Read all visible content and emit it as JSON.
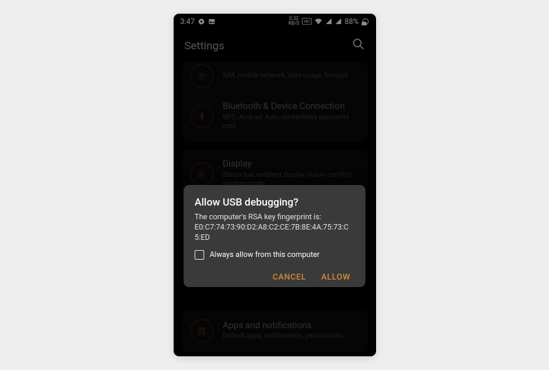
{
  "statusbar": {
    "time": "3:47",
    "data_speed_top": "0.32",
    "data_speed_bottom": "KB/S",
    "battery": "88%"
  },
  "appbar": {
    "title": "Settings"
  },
  "rows": {
    "wifi": {
      "sub": "SIM, mobile network, data usage, hotspot"
    },
    "bt": {
      "title": "Bluetooth & Device Connection",
      "sub": "NFC, Android Auto, contactless payments cast"
    },
    "display": {
      "title": "Display",
      "sub": "Status bar, ambient display, vision comfort, reading mode"
    },
    "apps": {
      "title": "Apps and notifications",
      "sub": "Default apps, notifications, permissions"
    }
  },
  "dialog": {
    "title": "Allow USB debugging?",
    "message_line1": "The computer's RSA key fingerprint is:",
    "message_line2": "E0:C7:74:73:90:D2:A8:C2:CE:7B:8E:4A:75:73:C5:ED",
    "checkbox_label": "Always allow from this computer",
    "cancel": "CANCEL",
    "allow": "ALLOW"
  }
}
